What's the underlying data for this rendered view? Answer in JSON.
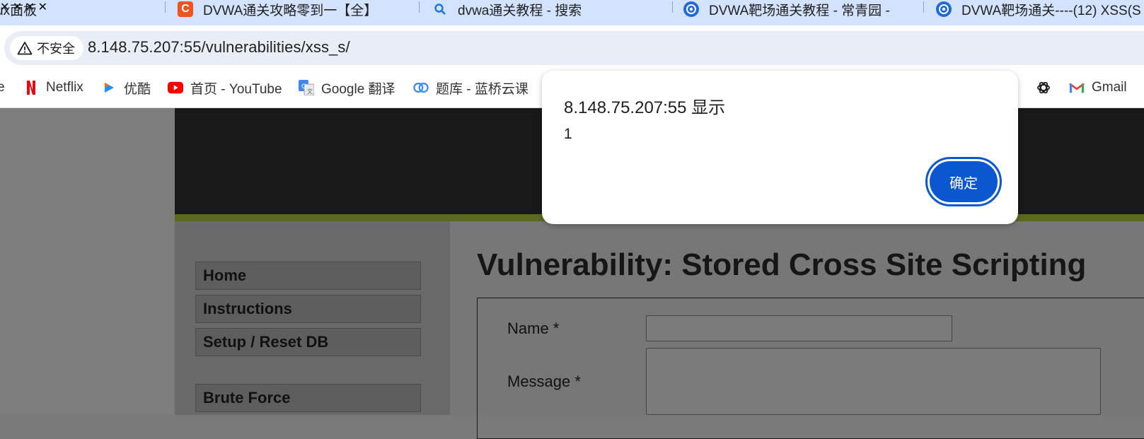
{
  "tabs": [
    {
      "title": "ux面板",
      "icon": "none"
    },
    {
      "title": "DVWA通关攻略零到一【全】-C",
      "icon": "csdn-icon",
      "favicon_text": "C"
    },
    {
      "title": "dvwa通关教程 - 搜索",
      "icon": "search-icon"
    },
    {
      "title": "DVWA靶场通关教程 - 常青园 -",
      "icon": "blog-icon"
    },
    {
      "title": "DVWA靶场通关----(12) XSS(S",
      "icon": "blog-icon"
    }
  ],
  "address_bar": {
    "security_label": "不安全",
    "url": "8.148.75.207:55/vulnerabilities/xss_s/"
  },
  "bookmarks": [
    {
      "label": "e",
      "icon": "none"
    },
    {
      "label": "Netflix",
      "icon": "netflix-icon"
    },
    {
      "label": "优酷",
      "icon": "youku-icon"
    },
    {
      "label": "首页 - YouTube",
      "icon": "youtube-icon"
    },
    {
      "label": "Google 翻译",
      "icon": "google-translate-icon"
    },
    {
      "label": "题库 - 蓝桥云课",
      "icon": "lanqiao-icon"
    },
    {
      "label": "",
      "icon": "chatgpt-icon"
    },
    {
      "label": "Gmail",
      "icon": "gmail-icon"
    }
  ],
  "dialog": {
    "title": "8.148.75.207:55 显示",
    "message": "1",
    "ok_label": "确定"
  },
  "dvwa": {
    "menu": [
      "Home",
      "Instructions",
      "Setup / Reset DB",
      "Brute Force"
    ],
    "heading": "Vulnerability: Stored Cross Site Scripting",
    "form": {
      "name_label": "Name *",
      "message_label": "Message *"
    }
  },
  "colors": {
    "tabstrip": "#d3e2fd",
    "accent": "#0b57d0",
    "dvwa_green": "#5b6b1e"
  }
}
